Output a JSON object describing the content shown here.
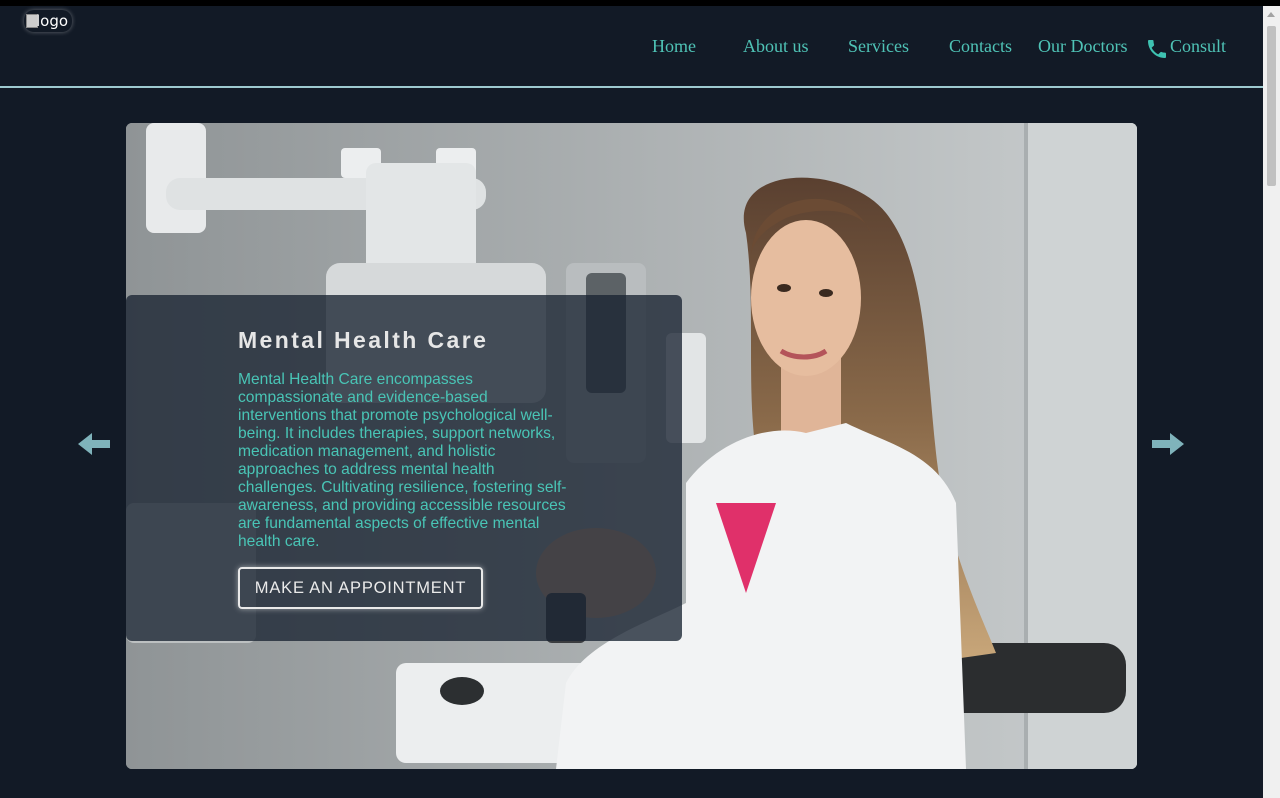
{
  "header": {
    "logo_alt": "logo",
    "nav": {
      "home": "Home",
      "about": "About us",
      "services": "Services",
      "contacts": "Contacts",
      "doctors": "Our Doctors",
      "consult": "Consult"
    }
  },
  "slide": {
    "title": "Mental Health Care",
    "description": "Mental Health Care encompasses compassionate and evidence-based interventions that promote psychological well-being. It includes therapies, support networks, medication management, and holistic approaches to address mental health challenges. Cultivating resilience, fostering self-awareness, and providing accessible resources are fundamental aspects of effective mental health care.",
    "button_label": "MAKE AN APPOINTMENT"
  },
  "colors": {
    "background": "#121a26",
    "accent": "#4fc3b6",
    "arrow": "#7fb3bb"
  },
  "icons": {
    "prev": "arrow-left-icon",
    "next": "arrow-right-icon",
    "consult": "phone-icon"
  }
}
